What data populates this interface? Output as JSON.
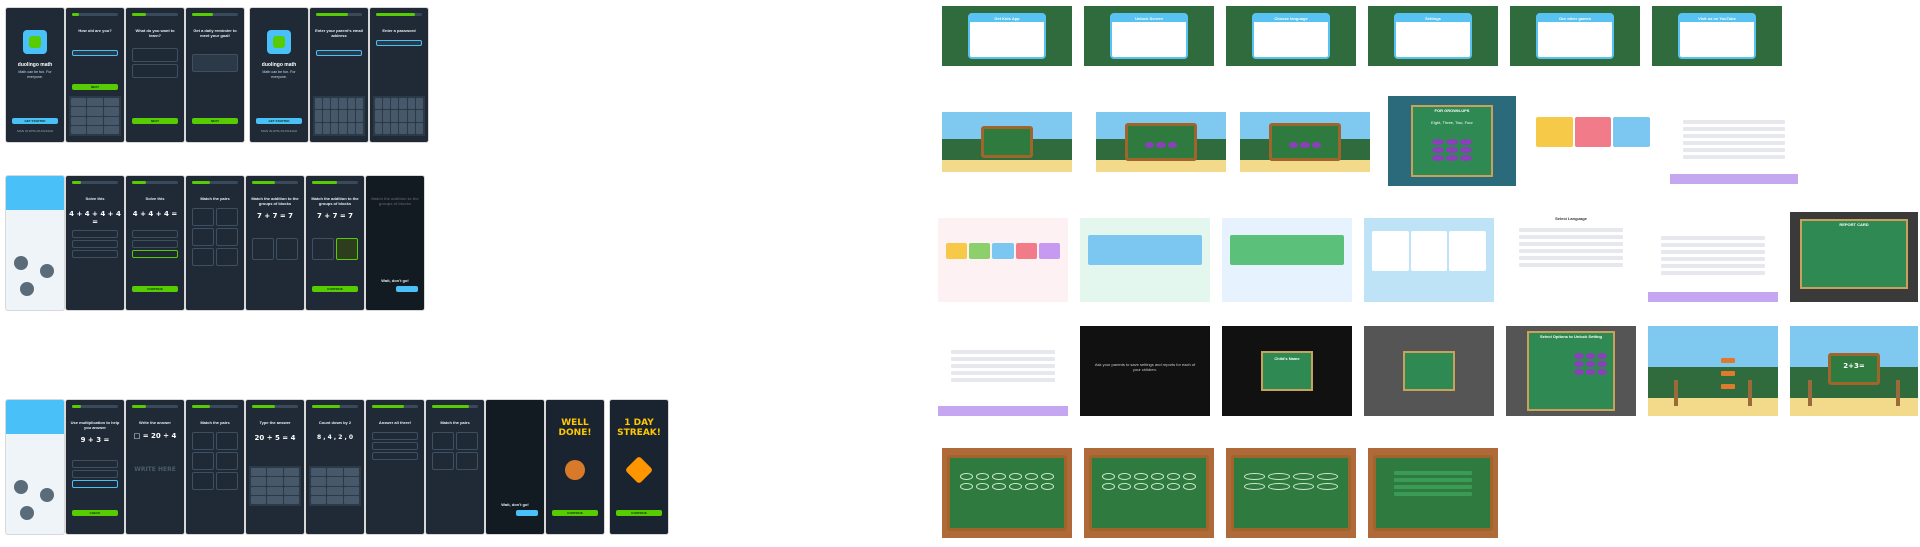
{
  "app": {
    "brand": "duolingo math",
    "tagline": "Math can be fun. For everyone."
  },
  "onboarding": {
    "get_started": "GET STARTED",
    "sign_in": "SIGN IN WITH DUOLINGO",
    "age_q": "How old are you?",
    "learn_q": "What do you want to learn?",
    "reminder_q": "Get a daily reminder to meet your goal!",
    "parent_email_q": "Enter your parent's email address",
    "password_q": "Enter a password",
    "next": "NEXT",
    "continue": "CONTINUE"
  },
  "lessons": {
    "solve_this": "Solve this",
    "match_pairs": "Match the pairs",
    "match_addition": "Match the addition to the groups of blocks",
    "well_dont_go": "Wait, don't go!",
    "use_mult": "Use multiplication to help you answer",
    "write_answer": "Write the answer",
    "type_answer": "Type the answer",
    "count_down": "Count down by 2",
    "answer_all_three": "Answer all three!",
    "eq1": "4 + 4 + 4 + 4 = ",
    "eq2": "4 + 4 + 4 = ",
    "eq3": "7 + 7 = 7",
    "eq4": "7 + 7 = 7",
    "eq5": "9 + 3 = ",
    "eq6": "□ = 20 ÷ 4",
    "eq7": "20 ÷ 5 = 4",
    "eq8": "8 , 4 , 2 , 0",
    "write_here": "WRITE HERE",
    "check": "CHECK",
    "well_done": "WELL DONE!",
    "streak": "1 DAY STREAK!",
    "claim": "CONTINUE"
  },
  "kids_app": {
    "dialog_get_app": "Get Kids App",
    "dialog_unlock": "Unlock Screen",
    "dialog_choose_language": "Choose language",
    "dialog_settings": "Settings",
    "dialog_other_games": "Our other games",
    "dialog_youtube": "Visit us on YouTube",
    "for_grownups": "FOR GROWN-UPS",
    "grownups_q": "Eight, Three, Two, Four",
    "select_language": "Select Language",
    "report_card": "REPORT CARD",
    "child_name": "Child's Name",
    "select_options": "Select Options to Unlock Setting",
    "parent_note": "Ask your parents to save settings and reports for each of your children.",
    "settings_rows": [
      "Launch with",
      "Allow Counting Number For Counting Books",
      "Show Hint While Learning",
      "Background Music",
      "Sounds",
      "Select Language"
    ],
    "sum_board": "2+3=",
    "colors": {
      "grass": "#2f6b3c",
      "sky": "#7fc8f0",
      "board": "#2f7a3e",
      "accent_blue": "#58c3f2",
      "purple": "#8b3fb8"
    }
  }
}
